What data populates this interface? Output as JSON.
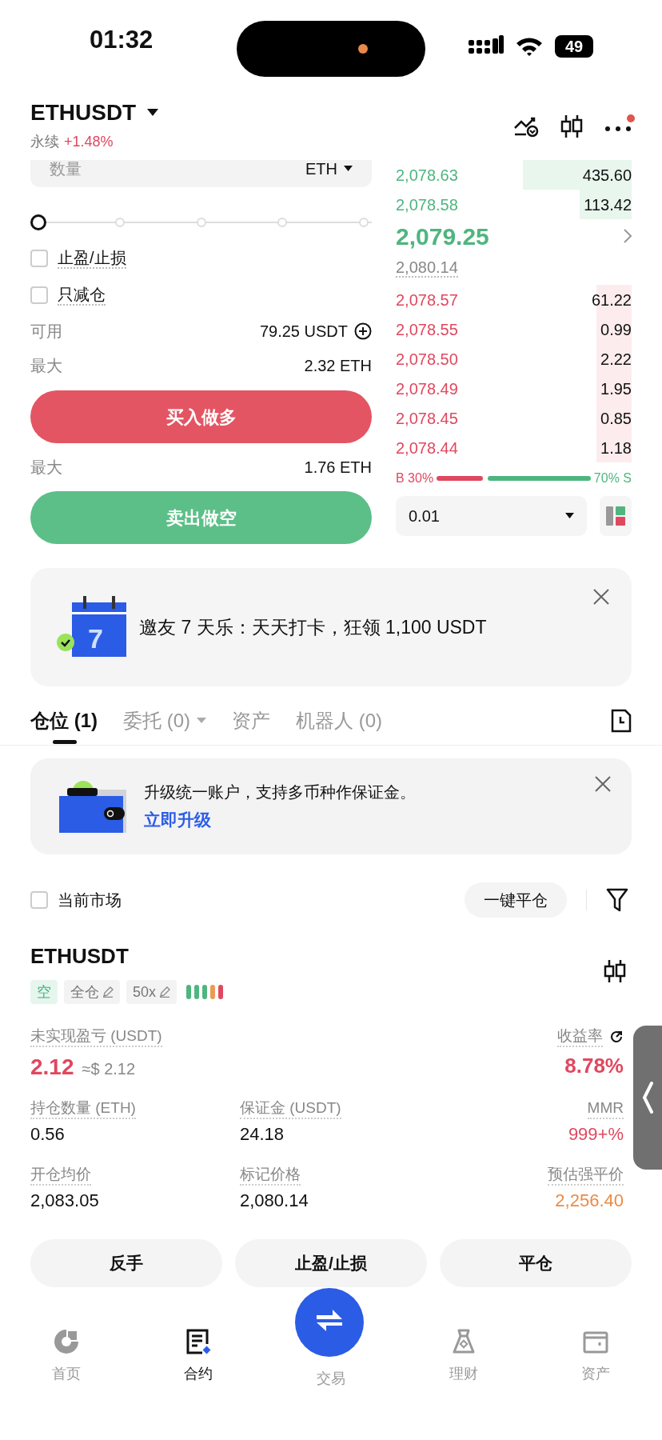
{
  "status_bar": {
    "time": "01:32",
    "battery": "49"
  },
  "header": {
    "symbol": "ETHUSDT",
    "type": "永续",
    "change": "+1.48%",
    "notification": true
  },
  "order_form": {
    "quantity": {
      "label": "数量",
      "unit": "ETH"
    },
    "slider": {
      "level": 0
    },
    "options": [
      {
        "label": "止盈/止损",
        "checked": false
      },
      {
        "label": "只减仓",
        "checked": false
      }
    ],
    "available": {
      "label": "可用",
      "value": "79.25 USDT"
    },
    "buy": {
      "max_label": "最大",
      "max_value": "2.32 ETH",
      "button": "买入做多"
    },
    "sell": {
      "max_label": "最大",
      "max_value": "1.76 ETH",
      "button": "卖出做空"
    }
  },
  "order_book": {
    "upper": [
      {
        "price": "2,078.63",
        "amount": "435.60",
        "level": 0.46
      },
      {
        "price": "2,078.58",
        "amount": "113.42",
        "level": 0.22
      }
    ],
    "last_price": "2,079.25",
    "mark_price": "2,080.14",
    "lower": [
      {
        "price": "2,078.57",
        "amount": "61.22",
        "level": 0.15
      },
      {
        "price": "2,078.55",
        "amount": "0.99",
        "level": 0.15
      },
      {
        "price": "2,078.50",
        "amount": "2.22",
        "level": 0.15
      },
      {
        "price": "2,078.49",
        "amount": "1.95",
        "level": 0.15
      },
      {
        "price": "2,078.45",
        "amount": "0.85",
        "level": 0.15
      },
      {
        "price": "2,078.44",
        "amount": "1.18",
        "level": 0.15
      }
    ],
    "ratio": {
      "buy_label": "B 30%",
      "sell_label": "70% S"
    },
    "precision": "0.01"
  },
  "promo": {
    "calendar_day": "7",
    "text": "邀友 7 天乐：天天打卡，狂领 1,100 USDT"
  },
  "tabs": [
    {
      "label": "仓位 (1)",
      "dropdown": false,
      "selected": true
    },
    {
      "label": "委托 (0)",
      "dropdown": true,
      "selected": false
    },
    {
      "label": "资产",
      "dropdown": false,
      "selected": false
    },
    {
      "label": "机器人 (0)",
      "dropdown": false,
      "selected": false
    }
  ],
  "upgrade": {
    "text": "升级统一账户，支持多币种作保证金。",
    "link": "立即升级"
  },
  "positions": {
    "filter": {
      "label": "当前市场",
      "checked": false
    },
    "close_all": "一键平仓",
    "item": {
      "symbol": "ETHUSDT",
      "tags": [
        {
          "text": "空",
          "kind": "side"
        },
        {
          "text": "全仓",
          "kind": "editable"
        },
        {
          "text": "50x",
          "kind": "editable"
        }
      ],
      "risk_bars": [
        {
          "color": "#4fb57f"
        },
        {
          "color": "#4fb57f"
        },
        {
          "color": "#4fb57f"
        },
        {
          "color": "#ec9a55"
        },
        {
          "color": "#e0485f"
        }
      ],
      "pnl": {
        "label": "未实现盈亏 (USDT)",
        "value": "2.12",
        "approx": "≈$ 2.12"
      },
      "roe": {
        "label": "收益率",
        "value": "8.78%"
      },
      "fields": [
        {
          "label": "持仓数量 (ETH)",
          "value": "0.56",
          "color": "#111111"
        },
        {
          "label": "保证金 (USDT)",
          "value": "24.18",
          "color": "#111111"
        },
        {
          "label": "MMR",
          "value": "999+%",
          "color": "#e0485f"
        },
        {
          "label": "开仓均价",
          "value": "2,083.05",
          "color": "#111111"
        },
        {
          "label": "标记价格",
          "value": "2,080.14",
          "color": "#111111"
        },
        {
          "label": "预估强平价",
          "value": "2,256.40",
          "color": "#ec8a45"
        }
      ],
      "actions": [
        "反手",
        "止盈/止损",
        "平仓"
      ]
    }
  },
  "nav": [
    {
      "label": "首页",
      "selected": false
    },
    {
      "label": "合约",
      "selected": true
    },
    {
      "label": "交易",
      "selected": false
    },
    {
      "label": "理财",
      "selected": false
    },
    {
      "label": "资产",
      "selected": false
    }
  ]
}
